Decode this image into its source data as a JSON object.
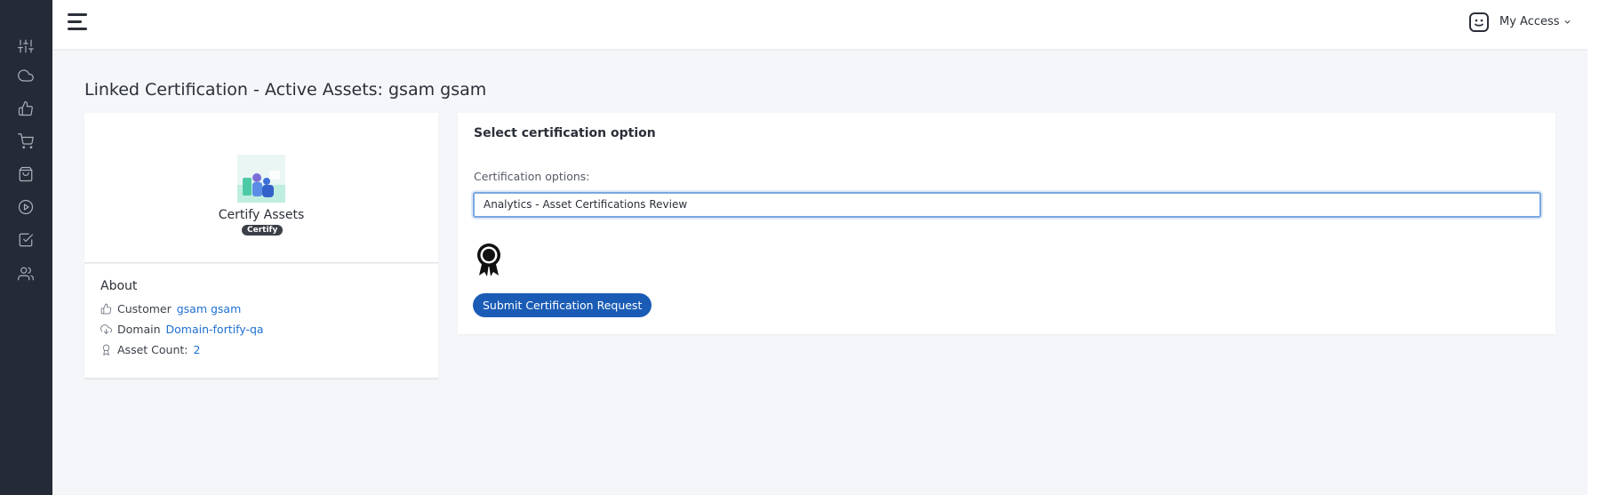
{
  "header": {
    "user_menu_label": "My Access"
  },
  "sidebar": {
    "items": [
      {
        "icon": "sliders-icon"
      },
      {
        "icon": "cloud-icon"
      },
      {
        "icon": "thumbs-up-icon"
      },
      {
        "icon": "cart-icon"
      },
      {
        "icon": "bag-icon"
      },
      {
        "icon": "play-circle-icon"
      },
      {
        "icon": "check-square-icon"
      },
      {
        "icon": "users-icon"
      }
    ]
  },
  "page": {
    "title": "Linked Certification - Active Assets: gsam gsam"
  },
  "certify_card": {
    "title": "Certify Assets",
    "badge": "Certify"
  },
  "about": {
    "title": "About",
    "customer_label": "Customer",
    "customer_value": "gsam gsam",
    "domain_label": "Domain",
    "domain_value": "Domain-fortify-qa",
    "asset_count_label": "Asset Count:",
    "asset_count_value": "2"
  },
  "certification": {
    "section_title": "Select certification option",
    "field_label": "Certification options:",
    "selected_option": "Analytics - Asset Certifications Review",
    "submit_label": "Submit Certification Request"
  },
  "colors": {
    "sidebar_bg": "#252b36",
    "accent": "#1a5cb5",
    "link": "#1f6fd1",
    "page_bg": "#f4f6f9"
  }
}
